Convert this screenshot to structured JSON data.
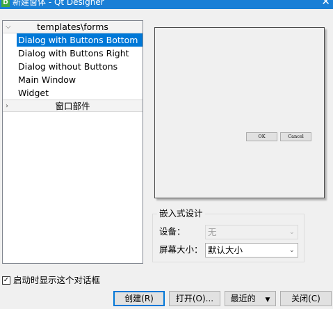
{
  "window": {
    "title": "新建窗体 - Qt Designer",
    "app_icon": "Qt Designer 'D' icon",
    "close_glyph": "✕"
  },
  "tree": {
    "categories": [
      {
        "label": "templates\\forms",
        "expanded": true,
        "items": [
          {
            "label": "Dialog with Buttons Bottom",
            "selected": true
          },
          {
            "label": "Dialog with Buttons Right",
            "selected": false
          },
          {
            "label": "Dialog without Buttons",
            "selected": false
          },
          {
            "label": "Main Window",
            "selected": false
          },
          {
            "label": "Widget",
            "selected": false
          }
        ]
      },
      {
        "label": "窗口部件",
        "expanded": false,
        "items": []
      }
    ]
  },
  "preview": {
    "ok_label": "OK",
    "cancel_label": "Cancel"
  },
  "embedded_design": {
    "group_title": "嵌入式设计",
    "device_label": "设备：",
    "device_value": "无",
    "device_enabled": false,
    "screen_size_label": "屏幕大小：",
    "screen_size_value": "默认大小"
  },
  "show_on_startup": {
    "label": "启动时显示这个对话框",
    "checked": true
  },
  "buttons": {
    "create": "创建(R)",
    "open": "打开(O)...",
    "recent": "最近的",
    "close": "关闭(C)"
  }
}
